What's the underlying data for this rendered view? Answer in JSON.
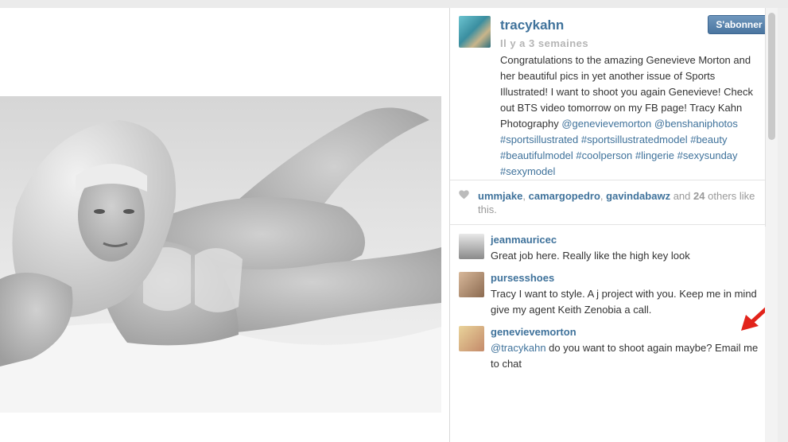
{
  "post": {
    "username": "tracykahn",
    "follow_label": "S'abonner",
    "timestamp": "Il y a 3 semaines",
    "caption_text": "Congratulations to the amazing Genevieve Morton and her beautiful pics in yet another issue of Sports Illustrated! I want to shoot you again Genevieve! Check out BTS video tomorrow on my FB page! Tracy Kahn Photography ",
    "caption_mentions": [
      "@genevievemorton",
      "@benshaniphotos"
    ],
    "caption_hashtags": [
      "#sportsillustrated",
      "#sportsillustratedmodel",
      "#beauty",
      "#beautifulmodel",
      "#coolperson",
      "#lingerie",
      "#sexysunday",
      "#sexymodel"
    ]
  },
  "likes": {
    "users": [
      "ummjake",
      "camargopedro",
      "gavindabawz"
    ],
    "and_text": "and",
    "others_count": "24",
    "suffix": "others like this."
  },
  "comments": [
    {
      "user": "jeanmauricec",
      "text": "Great job here. Really like the high key look"
    },
    {
      "user": "pursesshoes",
      "text": "Tracy I want to style. A j project with you. Keep me in mind give my agent Keith Zenobia a call."
    },
    {
      "user": "genevievemorton",
      "mention": "@tracykahn",
      "text": " do you want to shoot again maybe? Email me to chat"
    }
  ],
  "colors": {
    "link": "#3f729b",
    "annotation_arrow": "#e2231a",
    "follow_button": "#4a75a0"
  }
}
